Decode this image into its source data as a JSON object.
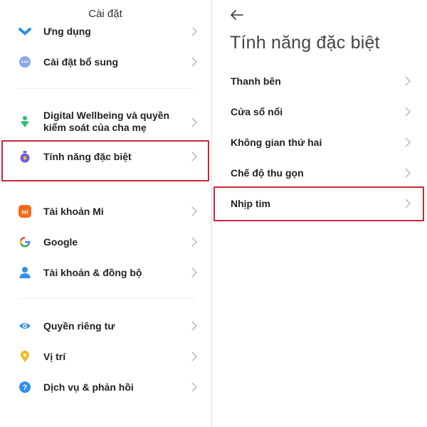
{
  "left_panel": {
    "title": "Cài đặt",
    "items": [
      {
        "label": "Ứng dụng",
        "icon": "apps-icon"
      },
      {
        "label": "Cài đặt bổ sung",
        "icon": "more-dots-icon"
      },
      {
        "label_line1": "Digital Wellbeing và quyền",
        "label_line2": "kiểm soát của cha mẹ",
        "icon": "wellbeing-icon"
      },
      {
        "label": "Tính năng đặc biệt",
        "icon": "special-features-icon"
      },
      {
        "label": "Tài khoản Mi",
        "icon": "mi-logo-icon"
      },
      {
        "label": "Google",
        "icon": "google-icon"
      },
      {
        "label": "Tài khoản & đồng bộ",
        "icon": "account-icon"
      },
      {
        "label": "Quyền riêng tư",
        "icon": "eye-icon"
      },
      {
        "label": "Vị trí",
        "icon": "location-pin-icon"
      },
      {
        "label": "Dịch vụ & phản hồi",
        "icon": "help-icon"
      }
    ]
  },
  "right_panel": {
    "title": "Tính năng đặc biệt",
    "items": [
      {
        "label": "Thanh bên"
      },
      {
        "label": "Cửa sổ nổi"
      },
      {
        "label": "Không gian thứ hai"
      },
      {
        "label": "Chế độ thu gọn"
      },
      {
        "label": "Nhịp tim"
      }
    ]
  },
  "colors": {
    "highlight": "#c9283a",
    "icon_blue": "#2f8fe8",
    "icon_green": "#2fbf71",
    "icon_purple": "#6e5ae6",
    "icon_orange": "#f26a1b",
    "icon_yellow": "#f5b820"
  }
}
